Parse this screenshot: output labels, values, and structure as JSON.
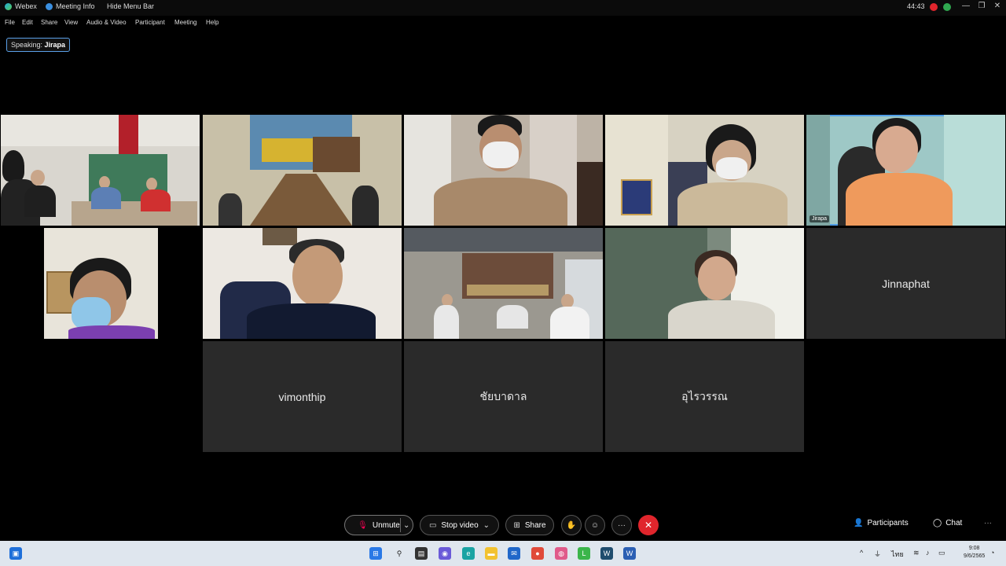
{
  "titlebar": {
    "app_name": "Webex",
    "meeting_info": "Meeting Info",
    "hide_menu": "Hide Menu Bar",
    "timer": "44:43",
    "minimize": "—",
    "restore": "❐",
    "close": "✕"
  },
  "menu": [
    "File",
    "Edit",
    "Share",
    "View",
    "Audio & Video",
    "Participant",
    "Meeting",
    "Help"
  ],
  "speaking": {
    "prefix": "Speaking:",
    "name": "Jirapa"
  },
  "tiles": {
    "jirapa_label": "Jirapa",
    "jinnaphat": "Jinnaphat",
    "vimonthip": "vimonthip",
    "chaibadan": "ชัยบาดาล",
    "uraiwan": "อุไรวรรณ"
  },
  "controls": {
    "unmute": "Unmute",
    "stop_video": "Stop video",
    "share": "Share",
    "more": "···",
    "participants": "Participants",
    "chat": "Chat"
  },
  "taskbar": {
    "language": "ไทย",
    "time": "9:08",
    "date": "9/6/2565"
  },
  "colors": {
    "active_border": "#4f9de8",
    "end_call": "#e0252c",
    "tile_bg": "#2a2a2a"
  }
}
